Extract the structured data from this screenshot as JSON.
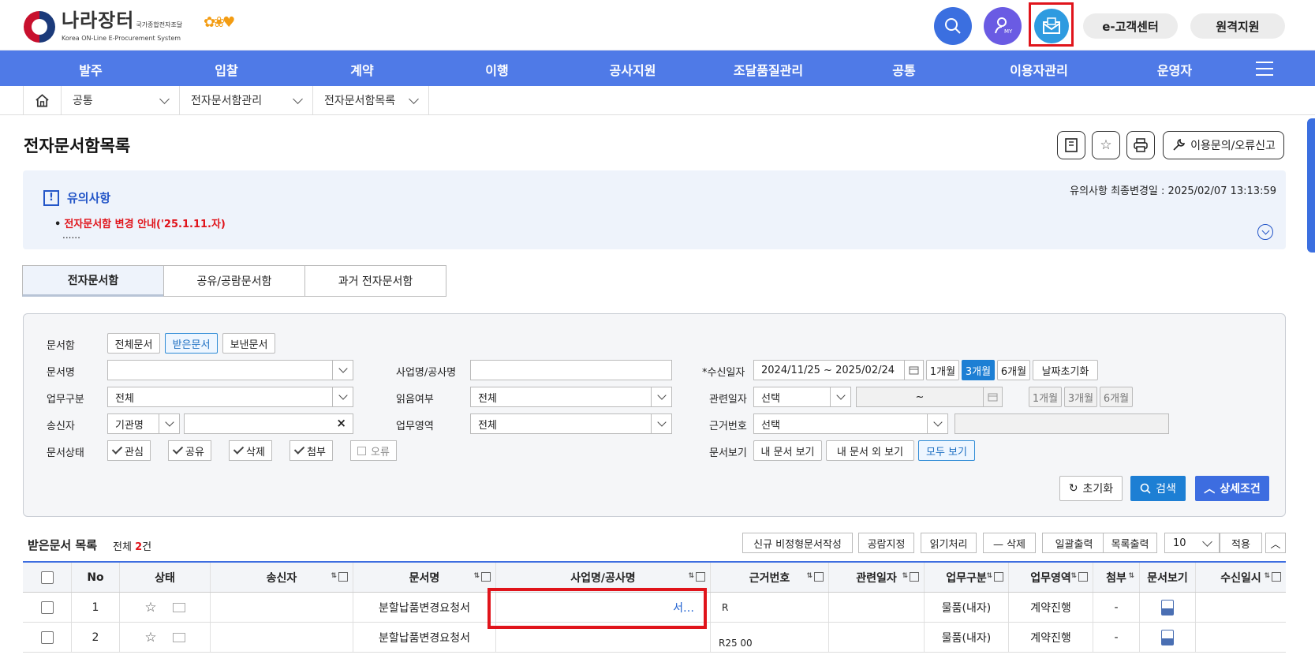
{
  "logo": {
    "name": "나라장터",
    "sub": "국가종합전자조달",
    "eng": "Korea ON-Line E-Procurement System"
  },
  "header": {
    "btn_customer": "e-고객센터",
    "btn_remote": "원격지원",
    "my_label": "MY"
  },
  "nav": [
    "발주",
    "입찰",
    "계약",
    "이행",
    "공사지원",
    "조달품질관리",
    "공통",
    "이용자관리",
    "운영자"
  ],
  "breadcrumb": [
    "공통",
    "전자문서함관리",
    "전자문서함목록"
  ],
  "page": {
    "title": "전자문서함목록",
    "inquiry": "이용문의/오류신고"
  },
  "notice": {
    "title": "유의사항",
    "updated": "유의사항 최종변경일 : 2025/02/07 13:13:59",
    "item": "전자문서함 변경 안내('25.1.11.자)",
    "more": "......"
  },
  "tabs": [
    "전자문서함",
    "공유/공람문서함",
    "과거 전자문서함"
  ],
  "search": {
    "docbox_label": "문서함",
    "docbox_opts": [
      "전체문서",
      "받은문서",
      "보낸문서"
    ],
    "docname_label": "문서명",
    "bizname_label": "사업명/공사명",
    "recvdate_label": "*수신일자",
    "recvdate_value": "2024/11/25  ~  2025/02/24",
    "period": [
      "1개월",
      "3개월",
      "6개월"
    ],
    "date_reset": "날짜초기화",
    "task_label": "업무구분",
    "task_value": "전체",
    "read_label": "읽음여부",
    "read_value": "전체",
    "reldate_label": "관련일자",
    "reldate_value": "선택",
    "reldate_sep": "~",
    "sender_label": "송신자",
    "sender_type": "기관명",
    "sender_clear": "×",
    "area_label": "업무영역",
    "area_value": "전체",
    "basis_label": "근거번호",
    "basis_value": "선택",
    "status_label": "문서상태",
    "status_opts": [
      "관심",
      "공유",
      "삭제",
      "첨부",
      "오류"
    ],
    "view_label": "문서보기",
    "view_opts": [
      "내 문서 보기",
      "내 문서 외 보기",
      "모두 보기"
    ],
    "reset": "초기화",
    "search": "검색",
    "detail": "상세조건"
  },
  "list": {
    "title": "받은문서 목록",
    "count_prefix": "전체 ",
    "count": "2",
    "count_suffix": "건",
    "buttons": [
      "신규 비정형문서작성",
      "공람지정",
      "읽기처리",
      "— 삭제",
      "일괄출력",
      "목록출력"
    ],
    "pagesize": "10",
    "apply": "적용",
    "columns": [
      "No",
      "상태",
      "송신자",
      "문서명",
      "사업명/공사명",
      "근거번호",
      "관련일자",
      "업무구분",
      "업무영역",
      "첨부",
      "문서보기",
      "수신일시"
    ],
    "rows": [
      {
        "no": "1",
        "docname": "분할납품변경요청서",
        "biz": "서…",
        "basis": "R",
        "reldate": "",
        "task": "물품(내자)",
        "area": "계약진행",
        "attach": "-"
      },
      {
        "no": "2",
        "docname": "분할납품변경요청서",
        "biz": "",
        "basis": "R25 00",
        "reldate": "",
        "task": "물품(내자)",
        "area": "계약진행",
        "attach": "-"
      }
    ]
  }
}
